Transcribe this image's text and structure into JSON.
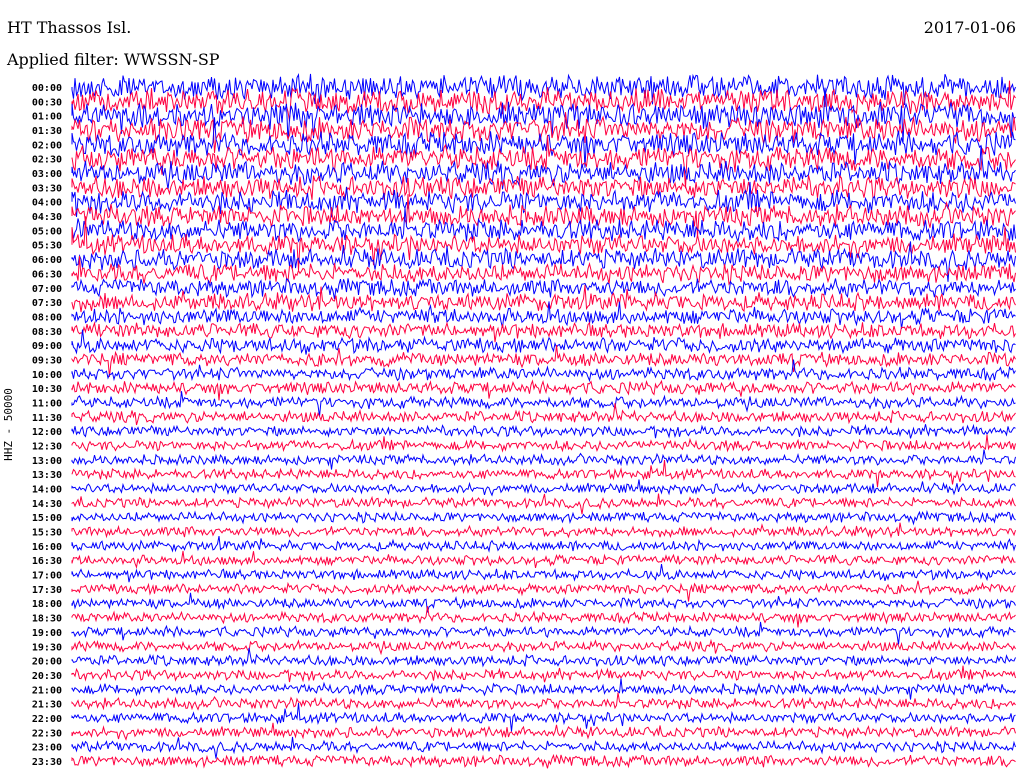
{
  "header": {
    "station": "HT Thassos Isl.",
    "date": "2017-01-06",
    "filter": "Applied filter: WWSSN-SP"
  },
  "chart_data": {
    "type": "line",
    "title": "HT Thassos Isl.",
    "ylabel": "HHZ - 50000",
    "xlabel": "",
    "colors": {
      "even_hour": "#0000ff",
      "half_hour": "#ff0040"
    },
    "rows": [
      "00:00",
      "00:30",
      "01:00",
      "01:30",
      "02:00",
      "02:30",
      "03:00",
      "03:30",
      "04:00",
      "04:30",
      "05:00",
      "05:30",
      "06:00",
      "06:30",
      "07:00",
      "07:30",
      "08:00",
      "08:30",
      "09:00",
      "09:30",
      "10:00",
      "10:30",
      "11:00",
      "11:30",
      "12:00",
      "12:30",
      "13:00",
      "13:30",
      "14:00",
      "14:30",
      "15:00",
      "15:30",
      "16:00",
      "16:30",
      "17:00",
      "17:30",
      "18:00",
      "18:30",
      "19:00",
      "19:30",
      "20:00",
      "20:30",
      "21:00",
      "21:30",
      "22:00",
      "22:30",
      "23:00",
      "23:30"
    ],
    "relative_amplitude": [
      1.0,
      1.0,
      1.0,
      1.0,
      0.95,
      0.95,
      0.9,
      0.9,
      0.9,
      0.85,
      0.85,
      0.8,
      0.8,
      0.75,
      0.7,
      0.7,
      0.65,
      0.6,
      0.6,
      0.55,
      0.5,
      0.5,
      0.45,
      0.45,
      0.42,
      0.42,
      0.4,
      0.4,
      0.4,
      0.4,
      0.4,
      0.4,
      0.4,
      0.4,
      0.4,
      0.4,
      0.4,
      0.4,
      0.4,
      0.4,
      0.42,
      0.42,
      0.42,
      0.42,
      0.42,
      0.42,
      0.42,
      0.45
    ]
  }
}
